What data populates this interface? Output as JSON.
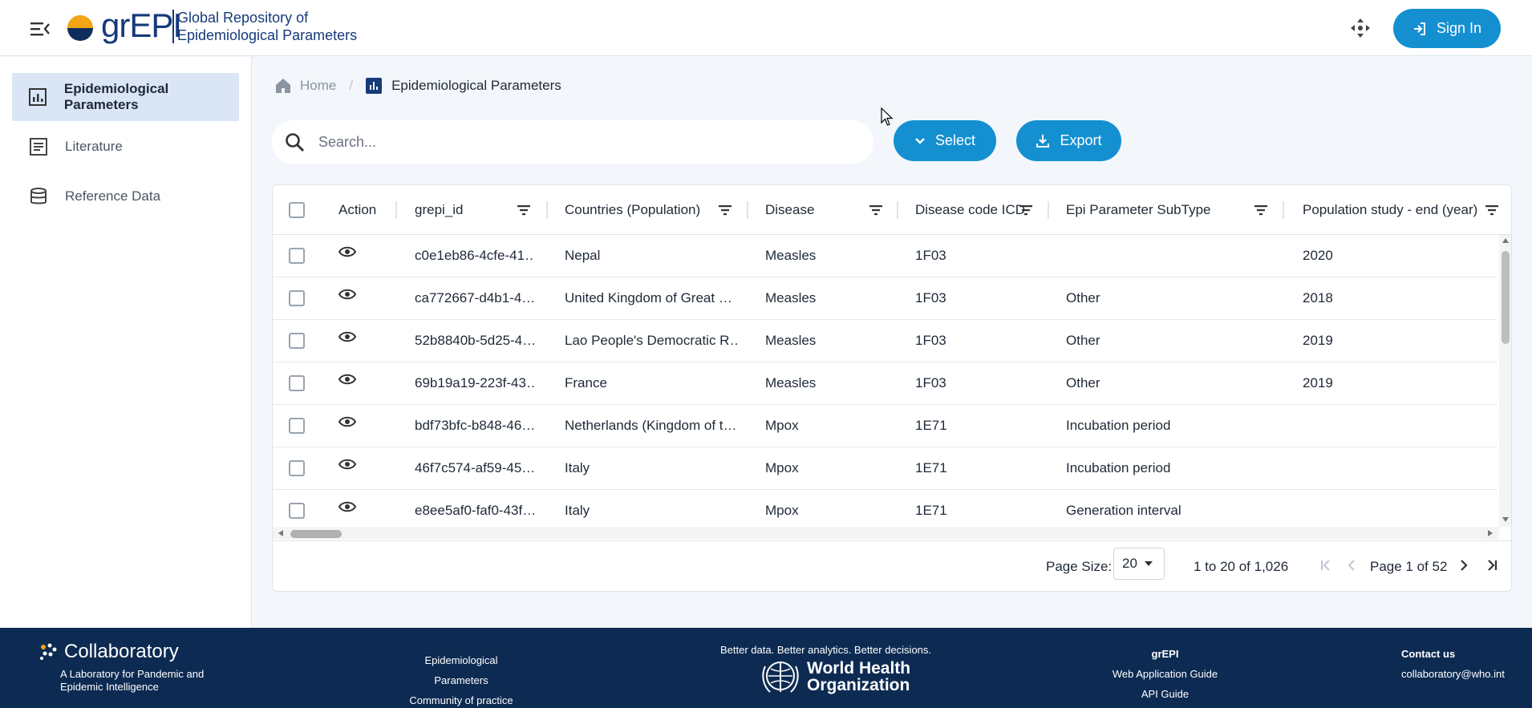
{
  "header": {
    "logo_text": "grEPI",
    "logo_subtitle_line1": "Global Repository of",
    "logo_subtitle_line2": "Epidemiological Parameters",
    "signin_label": "Sign In",
    "accent": "#1490d1"
  },
  "sidebar": {
    "items": [
      {
        "label": "Epidemiological Parameters",
        "icon": "bar-chart-icon",
        "active": true
      },
      {
        "label": "Literature",
        "icon": "document-list-icon",
        "active": false
      },
      {
        "label": "Reference Data",
        "icon": "database-icon",
        "active": false
      }
    ]
  },
  "breadcrumb": {
    "home": "Home",
    "separator": "/",
    "current": "Epidemiological Parameters"
  },
  "toolbar": {
    "search_placeholder": "Search...",
    "select_label": "Select",
    "export_label": "Export"
  },
  "grid": {
    "columns": [
      "Action",
      "grepi_id",
      "Countries (Population)",
      "Disease",
      "Disease code ICD",
      "Epi Parameter SubType",
      "Population study - end (year)"
    ],
    "rows": [
      {
        "id": "c0e1eb86-4cfe-41…",
        "country": "Nepal",
        "disease": "Measles",
        "icd": "1F03",
        "subtype": "",
        "end_year": "2020"
      },
      {
        "id": "ca772667-d4b1-4…",
        "country": "United Kingdom of Great …",
        "disease": "Measles",
        "icd": "1F03",
        "subtype": "Other",
        "end_year": "2018"
      },
      {
        "id": "52b8840b-5d25-4…",
        "country": "Lao People's Democratic R…",
        "disease": "Measles",
        "icd": "1F03",
        "subtype": "Other",
        "end_year": "2019"
      },
      {
        "id": "69b19a19-223f-43…",
        "country": "France",
        "disease": "Measles",
        "icd": "1F03",
        "subtype": "Other",
        "end_year": "2019"
      },
      {
        "id": "bdf73bfc-b848-46…",
        "country": "Netherlands (Kingdom of t…",
        "disease": "Mpox",
        "icd": "1E71",
        "subtype": "Incubation period",
        "end_year": ""
      },
      {
        "id": "46f7c574-af59-45…",
        "country": "Italy",
        "disease": "Mpox",
        "icd": "1E71",
        "subtype": "Incubation period",
        "end_year": ""
      },
      {
        "id": "e8ee5af0-faf0-43f…",
        "country": "Italy",
        "disease": "Mpox",
        "icd": "1E71",
        "subtype": "Generation interval",
        "end_year": ""
      }
    ],
    "footer": {
      "page_size_label": "Page Size:",
      "page_size_value": "20",
      "range_text": "1 to 20 of 1,026",
      "page_text": "Page 1 of 52"
    }
  },
  "footer": {
    "collab_title": "Collaboratory",
    "collab_sub_line1": "A Laboratory for Pandemic and",
    "collab_sub_line2": "Epidemic Intelligence",
    "link_epi": "Epidemiological Parameters",
    "link_community": "Community of practice",
    "who_tagline": "Better data. Better analytics. Better decisions.",
    "who_name_line1": "World Health",
    "who_name_line2": "Organization",
    "grepi_heading": "grEPI",
    "link_guide": "Web Application Guide",
    "link_api": "API Guide",
    "contact_heading": "Contact us",
    "contact_email": "collaboratory@who.int",
    "bg_color": "#0d2b52"
  }
}
